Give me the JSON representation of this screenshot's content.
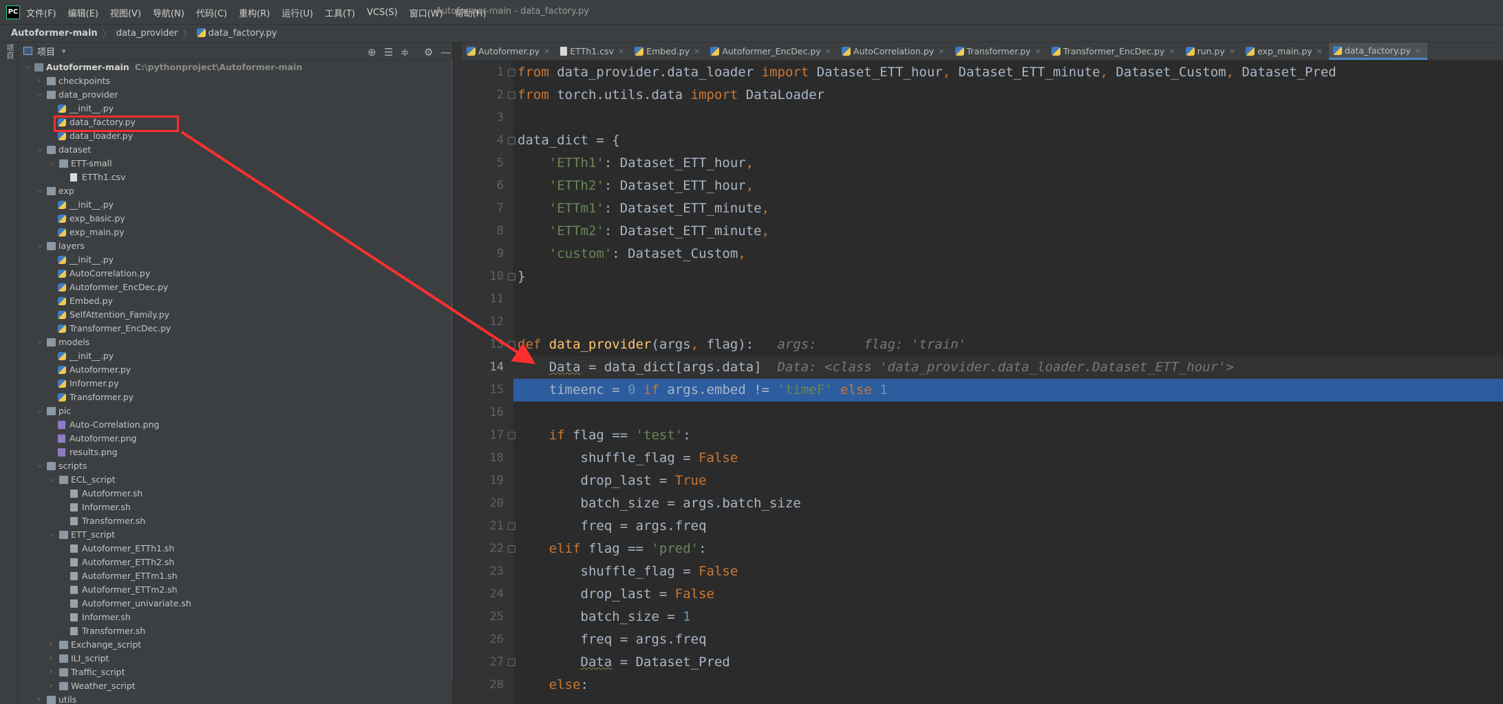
{
  "app": {
    "logo": "PC",
    "window_title": "Autoformer-main - data_factory.py",
    "menu": [
      "文件(F)",
      "编辑(E)",
      "视图(V)",
      "导航(N)",
      "代码(C)",
      "重构(R)",
      "运行(U)",
      "工具(T)",
      "VCS(S)",
      "窗口(W)",
      "帮助(H)"
    ]
  },
  "breadcrumb": {
    "root": "Autoformer-main",
    "folder": "data_provider",
    "file": "data_factory.py",
    "separator": "〉"
  },
  "tool_strip": {
    "label": "项目"
  },
  "project_panel": {
    "title": "项目",
    "dropdown_glyph": "▾",
    "icons": [
      "locate-icon",
      "expand-all-icon",
      "collapse-all-icon",
      "gear-icon",
      "minimize-icon"
    ],
    "root_path": "C:\\pythonproject\\Autoformer-main",
    "tree": [
      {
        "label": "Autoformer-main",
        "type": "root",
        "depth": 0,
        "arrow": "open"
      },
      {
        "label": "checkpoints",
        "type": "folder",
        "depth": 1,
        "arrow": "closed"
      },
      {
        "label": "data_provider",
        "type": "folder",
        "depth": 1,
        "arrow": "open"
      },
      {
        "label": "__init__.py",
        "type": "py",
        "depth": 2,
        "arrow": ""
      },
      {
        "label": "data_factory.py",
        "type": "py",
        "depth": 2,
        "arrow": ""
      },
      {
        "label": "data_loader.py",
        "type": "py",
        "depth": 2,
        "arrow": ""
      },
      {
        "label": "dataset",
        "type": "folder",
        "depth": 1,
        "arrow": "open"
      },
      {
        "label": "ETT-small",
        "type": "folder",
        "depth": 2,
        "arrow": "open"
      },
      {
        "label": "ETTh1.csv",
        "type": "csv",
        "depth": 3,
        "arrow": ""
      },
      {
        "label": "exp",
        "type": "folder",
        "depth": 1,
        "arrow": "open"
      },
      {
        "label": "__init__.py",
        "type": "py",
        "depth": 2,
        "arrow": ""
      },
      {
        "label": "exp_basic.py",
        "type": "py",
        "depth": 2,
        "arrow": ""
      },
      {
        "label": "exp_main.py",
        "type": "py",
        "depth": 2,
        "arrow": ""
      },
      {
        "label": "layers",
        "type": "folder",
        "depth": 1,
        "arrow": "open"
      },
      {
        "label": "__init__.py",
        "type": "py",
        "depth": 2,
        "arrow": ""
      },
      {
        "label": "AutoCorrelation.py",
        "type": "py",
        "depth": 2,
        "arrow": ""
      },
      {
        "label": "Autoformer_EncDec.py",
        "type": "py",
        "depth": 2,
        "arrow": ""
      },
      {
        "label": "Embed.py",
        "type": "py",
        "depth": 2,
        "arrow": ""
      },
      {
        "label": "SelfAttention_Family.py",
        "type": "py",
        "depth": 2,
        "arrow": ""
      },
      {
        "label": "Transformer_EncDec.py",
        "type": "py",
        "depth": 2,
        "arrow": ""
      },
      {
        "label": "models",
        "type": "folder",
        "depth": 1,
        "arrow": "open"
      },
      {
        "label": "__init__.py",
        "type": "py",
        "depth": 2,
        "arrow": ""
      },
      {
        "label": "Autoformer.py",
        "type": "py",
        "depth": 2,
        "arrow": ""
      },
      {
        "label": "Informer.py",
        "type": "py",
        "depth": 2,
        "arrow": ""
      },
      {
        "label": "Transformer.py",
        "type": "py",
        "depth": 2,
        "arrow": ""
      },
      {
        "label": "pic",
        "type": "folder",
        "depth": 1,
        "arrow": "open"
      },
      {
        "label": "Auto-Correlation.png",
        "type": "png",
        "depth": 2,
        "arrow": ""
      },
      {
        "label": "Autoformer.png",
        "type": "png",
        "depth": 2,
        "arrow": ""
      },
      {
        "label": "results.png",
        "type": "png",
        "depth": 2,
        "arrow": ""
      },
      {
        "label": "scripts",
        "type": "folder",
        "depth": 1,
        "arrow": "open"
      },
      {
        "label": "ECL_script",
        "type": "folder",
        "depth": 2,
        "arrow": "open"
      },
      {
        "label": "Autoformer.sh",
        "type": "sh",
        "depth": 3,
        "arrow": ""
      },
      {
        "label": "Informer.sh",
        "type": "sh",
        "depth": 3,
        "arrow": ""
      },
      {
        "label": "Transformer.sh",
        "type": "sh",
        "depth": 3,
        "arrow": ""
      },
      {
        "label": "ETT_script",
        "type": "folder",
        "depth": 2,
        "arrow": "open"
      },
      {
        "label": "Autoformer_ETTh1.sh",
        "type": "sh",
        "depth": 3,
        "arrow": ""
      },
      {
        "label": "Autoformer_ETTh2.sh",
        "type": "sh",
        "depth": 3,
        "arrow": ""
      },
      {
        "label": "Autoformer_ETTm1.sh",
        "type": "sh",
        "depth": 3,
        "arrow": ""
      },
      {
        "label": "Autoformer_ETTm2.sh",
        "type": "sh",
        "depth": 3,
        "arrow": ""
      },
      {
        "label": "Autoformer_univariate.sh",
        "type": "sh",
        "depth": 3,
        "arrow": ""
      },
      {
        "label": "Informer.sh",
        "type": "sh",
        "depth": 3,
        "arrow": ""
      },
      {
        "label": "Transformer.sh",
        "type": "sh",
        "depth": 3,
        "arrow": ""
      },
      {
        "label": "Exchange_script",
        "type": "folder",
        "depth": 2,
        "arrow": "closed"
      },
      {
        "label": "ILI_script",
        "type": "folder",
        "depth": 2,
        "arrow": "closed"
      },
      {
        "label": "Traffic_script",
        "type": "folder",
        "depth": 2,
        "arrow": "closed"
      },
      {
        "label": "Weather_script",
        "type": "folder",
        "depth": 2,
        "arrow": "closed"
      },
      {
        "label": "utils",
        "type": "folder",
        "depth": 1,
        "arrow": "closed"
      }
    ],
    "highlighted_item": "data_factory.py"
  },
  "tabs": [
    {
      "label": "Autoformer.py",
      "icon": "python-file-icon",
      "active": false
    },
    {
      "label": "ETTh1.csv",
      "icon": "csv-file-icon",
      "active": false
    },
    {
      "label": "Embed.py",
      "icon": "python-file-icon",
      "active": false
    },
    {
      "label": "Autoformer_EncDec.py",
      "icon": "python-file-icon",
      "active": false
    },
    {
      "label": "AutoCorrelation.py",
      "icon": "python-file-icon",
      "active": false
    },
    {
      "label": "Transformer.py",
      "icon": "python-file-icon",
      "active": false
    },
    {
      "label": "Transformer_EncDec.py",
      "icon": "python-file-icon",
      "active": false
    },
    {
      "label": "run.py",
      "icon": "python-file-icon",
      "active": false
    },
    {
      "label": "exp_main.py",
      "icon": "python-file-icon",
      "active": false
    },
    {
      "label": "data_factory.py",
      "icon": "python-file-icon",
      "active": true
    }
  ],
  "tab_close_glyph": "×",
  "editor": {
    "current_line": 14,
    "selected_line": 15,
    "lines": [
      {
        "n": 1,
        "fold": true,
        "tokens": [
          [
            "kw",
            "from "
          ],
          [
            "",
            "data_provider.data_loader "
          ],
          [
            "kw",
            "import "
          ],
          [
            "",
            "Dataset_ETT_hour"
          ],
          [
            "kw",
            ", "
          ],
          [
            "",
            "Dataset_ETT_minute"
          ],
          [
            "kw",
            ", "
          ],
          [
            "",
            "Dataset_Custom"
          ],
          [
            "kw",
            ", "
          ],
          [
            "",
            "Dataset_Pred"
          ]
        ]
      },
      {
        "n": 2,
        "fold": true,
        "tokens": [
          [
            "kw",
            "from "
          ],
          [
            "",
            "torch.utils.data "
          ],
          [
            "kw",
            "import "
          ],
          [
            "",
            "DataLoader"
          ]
        ]
      },
      {
        "n": 3,
        "fold": false,
        "tokens": []
      },
      {
        "n": 4,
        "fold": true,
        "tokens": [
          [
            "",
            "data_dict = {"
          ]
        ]
      },
      {
        "n": 5,
        "fold": false,
        "tokens": [
          [
            "",
            "    "
          ],
          [
            "str",
            "'ETTh1'"
          ],
          [
            "",
            ": Dataset_ETT_hour"
          ],
          [
            "kw",
            ","
          ]
        ]
      },
      {
        "n": 6,
        "fold": false,
        "tokens": [
          [
            "",
            "    "
          ],
          [
            "str",
            "'ETTh2'"
          ],
          [
            "",
            ": Dataset_ETT_hour"
          ],
          [
            "kw",
            ","
          ]
        ]
      },
      {
        "n": 7,
        "fold": false,
        "tokens": [
          [
            "",
            "    "
          ],
          [
            "str",
            "'ETTm1'"
          ],
          [
            "",
            ": Dataset_ETT_minute"
          ],
          [
            "kw",
            ","
          ]
        ]
      },
      {
        "n": 8,
        "fold": false,
        "tokens": [
          [
            "",
            "    "
          ],
          [
            "str",
            "'ETTm2'"
          ],
          [
            "",
            ": Dataset_ETT_minute"
          ],
          [
            "kw",
            ","
          ]
        ]
      },
      {
        "n": 9,
        "fold": false,
        "tokens": [
          [
            "",
            "    "
          ],
          [
            "str",
            "'custom'"
          ],
          [
            "",
            ": Dataset_Custom"
          ],
          [
            "kw",
            ","
          ]
        ]
      },
      {
        "n": 10,
        "fold": true,
        "tokens": [
          [
            "",
            "}"
          ]
        ]
      },
      {
        "n": 11,
        "fold": false,
        "tokens": []
      },
      {
        "n": 12,
        "fold": false,
        "tokens": []
      },
      {
        "n": 13,
        "fold": true,
        "tokens": [
          [
            "kw",
            "def "
          ],
          [
            "fn",
            "data_provider"
          ],
          [
            "",
            "(args"
          ],
          [
            "kw",
            ", "
          ],
          [
            "",
            "flag):   "
          ],
          [
            "hint",
            "args:      flag: 'train'"
          ]
        ]
      },
      {
        "n": 14,
        "fold": false,
        "tokens": [
          [
            "",
            "    "
          ],
          [
            "uline",
            "Data"
          ],
          [
            "",
            " = data_dict[args.data]  "
          ],
          [
            "hint",
            "Data: <class 'data_provider.data_loader.Dataset_ETT_hour'>"
          ]
        ]
      },
      {
        "n": 15,
        "fold": false,
        "tokens": [
          [
            "",
            "    timeenc = "
          ],
          [
            "num",
            "0 "
          ],
          [
            "kw",
            "if "
          ],
          [
            "",
            "args.embed != "
          ],
          [
            "str",
            "'timeF' "
          ],
          [
            "kw",
            "else "
          ],
          [
            "num",
            "1"
          ]
        ]
      },
      {
        "n": 16,
        "fold": false,
        "tokens": []
      },
      {
        "n": 17,
        "fold": true,
        "tokens": [
          [
            "",
            "    "
          ],
          [
            "kw",
            "if "
          ],
          [
            "",
            "flag == "
          ],
          [
            "str",
            "'test'"
          ],
          [
            "",
            ":"
          ]
        ]
      },
      {
        "n": 18,
        "fold": false,
        "tokens": [
          [
            "",
            "        shuffle_flag = "
          ],
          [
            "kw",
            "False"
          ]
        ]
      },
      {
        "n": 19,
        "fold": false,
        "tokens": [
          [
            "",
            "        drop_last = "
          ],
          [
            "kw",
            "True"
          ]
        ]
      },
      {
        "n": 20,
        "fold": false,
        "tokens": [
          [
            "",
            "        batch_size = args.batch_size"
          ]
        ]
      },
      {
        "n": 21,
        "fold": true,
        "tokens": [
          [
            "",
            "        freq = args.freq"
          ]
        ]
      },
      {
        "n": 22,
        "fold": true,
        "tokens": [
          [
            "",
            "    "
          ],
          [
            "kw",
            "elif "
          ],
          [
            "",
            "flag == "
          ],
          [
            "str",
            "'pred'"
          ],
          [
            "",
            ":"
          ]
        ]
      },
      {
        "n": 23,
        "fold": false,
        "tokens": [
          [
            "",
            "        shuffle_flag = "
          ],
          [
            "kw",
            "False"
          ]
        ]
      },
      {
        "n": 24,
        "fold": false,
        "tokens": [
          [
            "",
            "        drop_last = "
          ],
          [
            "kw",
            "False"
          ]
        ]
      },
      {
        "n": 25,
        "fold": false,
        "tokens": [
          [
            "",
            "        batch_size = "
          ],
          [
            "num",
            "1"
          ]
        ]
      },
      {
        "n": 26,
        "fold": false,
        "tokens": [
          [
            "",
            "        freq = args.freq"
          ]
        ]
      },
      {
        "n": 27,
        "fold": true,
        "tokens": [
          [
            "",
            "        "
          ],
          [
            "uline",
            "Data"
          ],
          [
            "",
            " = Dataset_Pred"
          ]
        ]
      },
      {
        "n": 28,
        "fold": false,
        "tokens": [
          [
            "",
            "    "
          ],
          [
            "kw",
            "else"
          ],
          [
            "",
            ":"
          ]
        ]
      }
    ]
  },
  "colors": {
    "annotation_red": "#ff2f2f",
    "selection_blue": "#2d5d9f",
    "keyword": "#cc7832",
    "string": "#6a8759",
    "number": "#6897bb",
    "function": "#ffc66d"
  }
}
